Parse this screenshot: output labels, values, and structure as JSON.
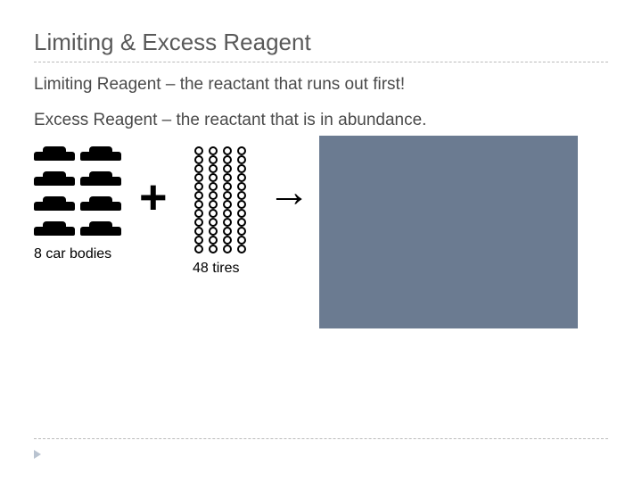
{
  "title": "Limiting & Excess Reagent",
  "defs": {
    "limiting": "Limiting Reagent – the reactant that runs out first!",
    "excess": "Excess Reagent – the reactant that is in abundance."
  },
  "diagram": {
    "cars_label": "8 car bodies",
    "tires_label": "48 tires",
    "plus": "+",
    "arrow": "→"
  },
  "counts": {
    "car_bodies": 8,
    "tires": 48
  }
}
